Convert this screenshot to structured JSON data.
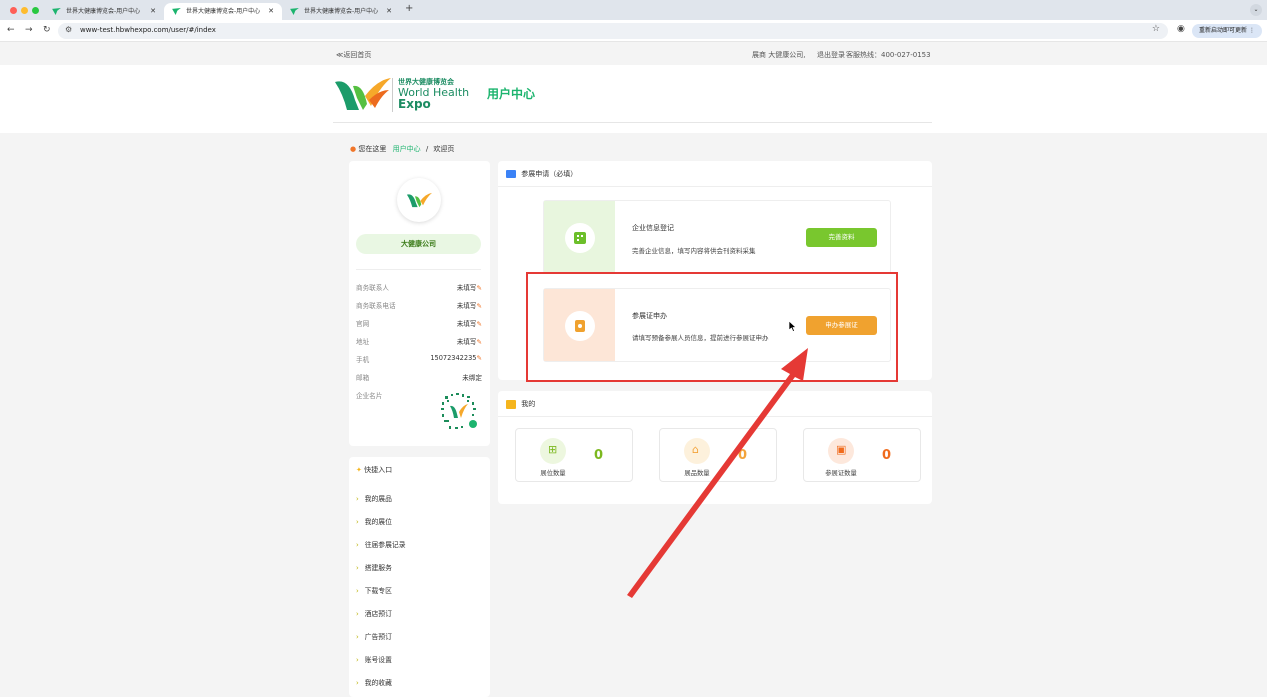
{
  "browser": {
    "tabs": [
      {
        "title": "世界大健康博览会-用户中心"
      },
      {
        "title": "世界大健康博览会-用户中心"
      },
      {
        "title": "世界大健康博览会-用户中心"
      }
    ],
    "url": "www-test.hbwhexpo.com/user/#/index",
    "restart_label": "重新启动即可更新"
  },
  "topbar": {
    "back_home": "≪返回首页",
    "account_text": "展商  大健康公司,",
    "logout": "退出登录",
    "hotline": "客服热线：400-027-0153"
  },
  "header": {
    "logo_cn": "世界大健康博览会",
    "logo_en1": "World Health",
    "logo_en2": "Expo",
    "section_title": "用户中心"
  },
  "breadcrumb": {
    "prefix": "您在这里",
    "current": "用户中心",
    "sep": "/",
    "page": "欢迎页"
  },
  "profile": {
    "company": "大健康公司",
    "fields": [
      {
        "label": "商务联系人",
        "value": "未填写"
      },
      {
        "label": "商务联系电话",
        "value": "未填写"
      },
      {
        "label": "官网",
        "value": "未填写"
      },
      {
        "label": "地址",
        "value": "未填写"
      },
      {
        "label": "手机",
        "value": "15072342235"
      },
      {
        "label": "邮箱",
        "value": "未绑定"
      },
      {
        "label": "企业名片",
        "value": ""
      }
    ]
  },
  "quick_links": {
    "title": "快捷入口",
    "items": [
      "我的展品",
      "我的展位",
      "往届参展记录",
      "搭建服务",
      "下载专区",
      "酒店预订",
      "广告预订",
      "账号设置",
      "我的收藏"
    ]
  },
  "application": {
    "title": "参展申请（必填）",
    "tasks": [
      {
        "title": "企业信息登记",
        "desc": "完善企业信息，填写内容将供会刊资料采集",
        "button": "完善资料"
      },
      {
        "title": "参展证申办",
        "desc": "请填写预备参展人员信息，提前进行参展证申办",
        "button": "申办参展证"
      }
    ]
  },
  "mine": {
    "title": "我的",
    "stats": [
      {
        "label": "展位数量",
        "value": "0",
        "color": "#7cb81f"
      },
      {
        "label": "展品数量",
        "value": "0",
        "color": "#f3a43b"
      },
      {
        "label": "参展证数量",
        "value": "0",
        "color": "#f06b1d"
      }
    ]
  },
  "colors": {
    "accent": "#1cb46e",
    "highlight": "#e53935"
  }
}
